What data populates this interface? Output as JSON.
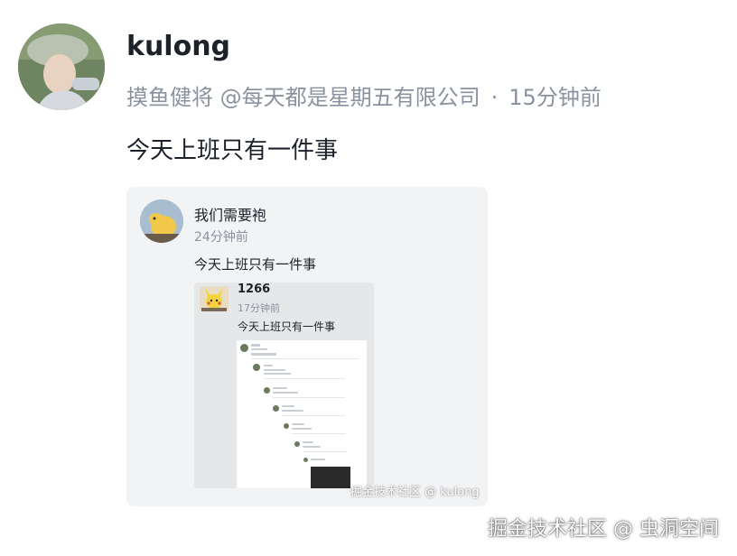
{
  "post": {
    "username": "kulong",
    "title_badge": "摸鱼健将 @每天都是星期五有限公司",
    "separator": "·",
    "time": "15分钟前",
    "content": "今天上班只有一件事"
  },
  "quote1": {
    "username": "我们需要袍",
    "time": "24分钟前",
    "content": "今天上班只有一件事"
  },
  "quote2": {
    "username": "1266",
    "time": "17分钟前",
    "content": "今天上班只有一件事"
  },
  "watermarks": {
    "inner": "掘金技术社区 @ kulong",
    "outer": "掘金技术社区 @ 虫洞空间"
  }
}
